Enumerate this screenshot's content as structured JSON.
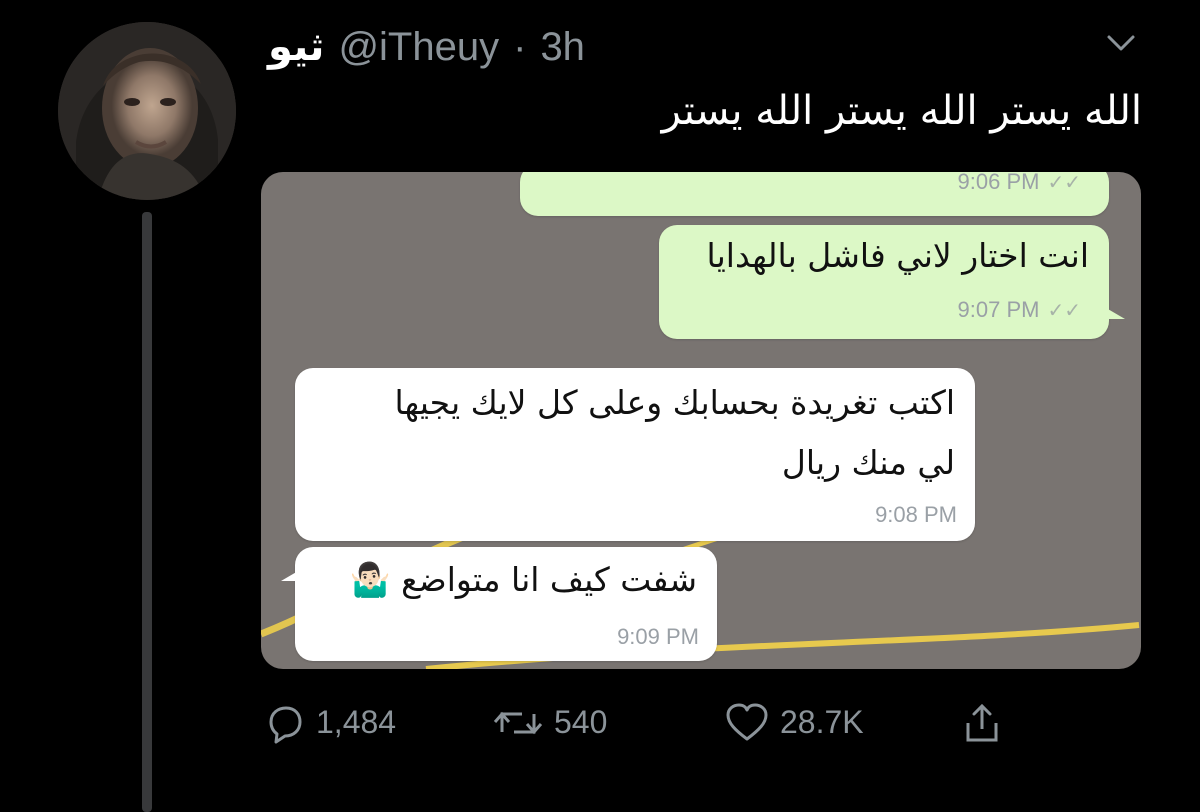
{
  "tweet": {
    "display_name": "ثيو",
    "handle": "@iTheuy",
    "separator": "·",
    "time": "3h",
    "text": "الله يستر الله يستر الله يستر",
    "avatar_icon": "avatar-portrait",
    "menu_icon": "chevron-down-icon"
  },
  "chat": {
    "messages": [
      {
        "direction": "outgoing",
        "text": "",
        "time": "9:06 PM",
        "ticks": "✓✓"
      },
      {
        "direction": "outgoing",
        "text": "انت اختار لاني فاشل بالهدايا",
        "time": "9:07 PM",
        "ticks": "✓✓"
      },
      {
        "direction": "incoming",
        "lines": [
          "اكتب تغريدة بحسابك وعلى كل لايك يجيها",
          "لي منك ريال"
        ],
        "time": "9:08 PM"
      },
      {
        "direction": "incoming",
        "text": "شفت كيف انا متواضع 🤷🏻‍♂️",
        "time": "9:09 PM"
      }
    ]
  },
  "actions": {
    "reply_count": "1,484",
    "retweet_count": "540",
    "like_count": "28.7K",
    "reply_icon": "reply-icon",
    "retweet_icon": "retweet-icon",
    "like_icon": "heart-icon",
    "share_icon": "share-icon"
  },
  "colors": {
    "background": "#000000",
    "muted_text": "#8b9399",
    "outgoing_bubble": "#dcf8c6",
    "incoming_bubble": "#ffffff",
    "chat_background": "#797471"
  }
}
